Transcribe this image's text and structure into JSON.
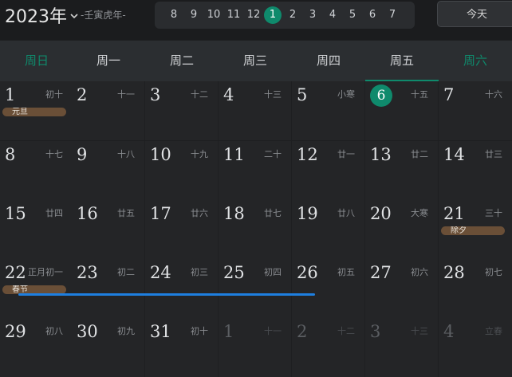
{
  "header": {
    "year_label": "2023年",
    "ganzhi": "-壬寅虎年-",
    "months": [
      "8",
      "9",
      "10",
      "11",
      "12",
      "1",
      "2",
      "3",
      "4",
      "5",
      "6",
      "7"
    ],
    "active_month": "1",
    "today_label": "今天"
  },
  "weekdays": [
    "周日",
    "周一",
    "周二",
    "周三",
    "周四",
    "周五",
    "周六"
  ],
  "weeks": [
    [
      {
        "day": "1",
        "lunar": "初十",
        "holiday": "元旦"
      },
      {
        "day": "2",
        "lunar": "十一"
      },
      {
        "day": "3",
        "lunar": "十二"
      },
      {
        "day": "4",
        "lunar": "十三"
      },
      {
        "day": "5",
        "lunar": "小寒"
      },
      {
        "day": "6",
        "lunar": "十五",
        "today": true
      },
      {
        "day": "7",
        "lunar": "十六"
      }
    ],
    [
      {
        "day": "8",
        "lunar": "十七"
      },
      {
        "day": "9",
        "lunar": "十八"
      },
      {
        "day": "10",
        "lunar": "十九"
      },
      {
        "day": "11",
        "lunar": "二十"
      },
      {
        "day": "12",
        "lunar": "廿一"
      },
      {
        "day": "13",
        "lunar": "廿二"
      },
      {
        "day": "14",
        "lunar": "廿三"
      }
    ],
    [
      {
        "day": "15",
        "lunar": "廿四"
      },
      {
        "day": "16",
        "lunar": "廿五"
      },
      {
        "day": "17",
        "lunar": "廿六"
      },
      {
        "day": "18",
        "lunar": "廿七"
      },
      {
        "day": "19",
        "lunar": "廿八"
      },
      {
        "day": "20",
        "lunar": "大寒"
      },
      {
        "day": "21",
        "lunar": "三十",
        "holiday": "除夕"
      }
    ],
    [
      {
        "day": "22",
        "lunar": "正月初一",
        "holiday": "春节"
      },
      {
        "day": "23",
        "lunar": "初二"
      },
      {
        "day": "24",
        "lunar": "初三"
      },
      {
        "day": "25",
        "lunar": "初四"
      },
      {
        "day": "26",
        "lunar": "初五"
      },
      {
        "day": "27",
        "lunar": "初六"
      },
      {
        "day": "28",
        "lunar": "初七"
      }
    ],
    [
      {
        "day": "29",
        "lunar": "初八"
      },
      {
        "day": "30",
        "lunar": "初九"
      },
      {
        "day": "31",
        "lunar": "初十"
      },
      {
        "day": "1",
        "lunar": "十一",
        "out": true
      },
      {
        "day": "2",
        "lunar": "十二",
        "out": true
      },
      {
        "day": "3",
        "lunar": "十三",
        "out": true
      },
      {
        "day": "4",
        "lunar": "立春",
        "out": true
      }
    ]
  ],
  "colors": {
    "accent": "#0f8a6c",
    "holiday_bar": "#6a4f37",
    "selection": "#1e7fe0"
  }
}
